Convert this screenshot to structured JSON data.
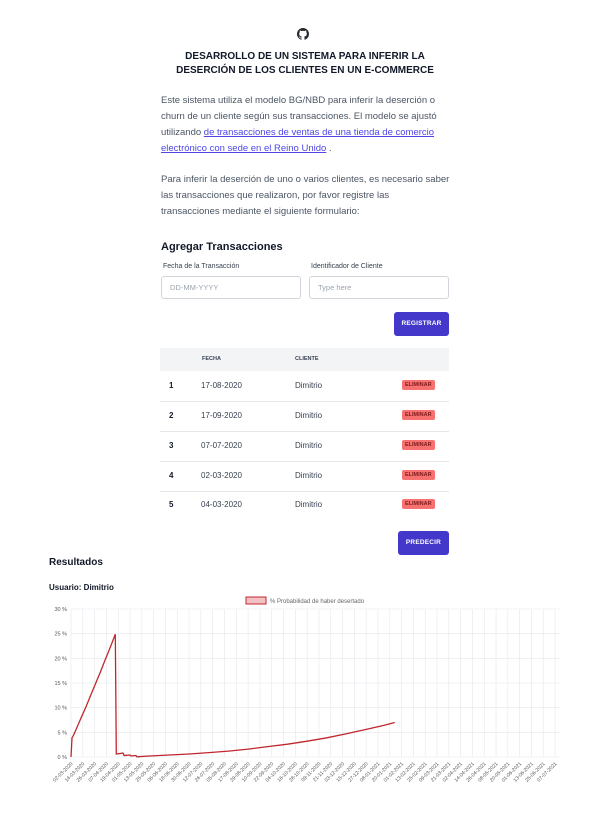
{
  "header": {
    "icon": "github-icon",
    "title_line1": "DESARROLLO DE UN SISTEMA PARA INFERIR LA",
    "title_line2": "DESERCIÓN DE LOS CLIENTES EN UN E-COMMERCE"
  },
  "intro": {
    "p1_line1": "Este sistema utiliza el modelo BG/NBD para inferir la deserción o",
    "p1_line2": "churn de un cliente según sus transacciones. El modelo se ajustó",
    "p1_line3_prefix": "utilizando ",
    "link_line1": "de transacciones de ventas de una tienda de comercio",
    "link_line2": "electrónico con sede en el Reino Unido",
    "p1_suffix": " .",
    "p2_line1": "Para inferir la deserción de uno o varios clientes, es necesario saber",
    "p2_line2": "las transacciones que realizaron, por favor registre las",
    "p2_line3": "transacciones mediante el siguiente formulario:"
  },
  "form": {
    "heading": "Agregar Transacciones",
    "date_label": "Fecha de la Transacción",
    "date_placeholder": "DD-MM-YYYY",
    "client_label": "Identificador de Cliente",
    "client_placeholder": "Type here",
    "submit_label": "REGISTRAR"
  },
  "table": {
    "headers": [
      "",
      "FECHA",
      "CLIENTE",
      ""
    ],
    "rows": [
      {
        "num": "1",
        "date": "17-08-2020",
        "client": "Dimitrio",
        "action": "ELIMINAR"
      },
      {
        "num": "2",
        "date": "17-09-2020",
        "client": "Dimitrio",
        "action": "ELIMINAR"
      },
      {
        "num": "3",
        "date": "07-07-2020",
        "client": "Dimitrio",
        "action": "ELIMINAR"
      },
      {
        "num": "4",
        "date": "02-03-2020",
        "client": "Dimitrio",
        "action": "ELIMINAR"
      },
      {
        "num": "5",
        "date": "04-03-2020",
        "client": "Dimitrio",
        "action": "ELIMINAR"
      }
    ],
    "predict_label": "PREDECIR"
  },
  "results": {
    "heading": "Resultados",
    "user_label": "Usuario: Dimitrio"
  },
  "chart_data": {
    "type": "line",
    "legend": "% Probabilidad de haber desertado",
    "legend_position": "top-center",
    "color": "#c0272d",
    "grid": true,
    "ylim": [
      0,
      30
    ],
    "yticks": [
      "0 %",
      "5 %",
      "10 %",
      "15 %",
      "20 %",
      "25 %",
      "30 %"
    ],
    "xticks": [
      "02-03-2020",
      "14-03-2020",
      "26-03-2020",
      "07-04-2020",
      "19-04-2020",
      "01-05-2020",
      "13-05-2020",
      "25-05-2020",
      "06-06-2020",
      "18-06-2020",
      "30-06-2020",
      "12-07-2020",
      "24-07-2020",
      "05-08-2020",
      "17-08-2020",
      "29-08-2020",
      "10-09-2020",
      "22-09-2020",
      "04-10-2020",
      "16-10-2020",
      "28-10-2020",
      "09-11-2020",
      "21-11-2020",
      "03-12-2020",
      "15-12-2020",
      "27-12-2020",
      "08-01-2021",
      "20-01-2021",
      "01-02-2021",
      "13-02-2021",
      "25-02-2021",
      "09-03-2021",
      "21-03-2021",
      "02-04-2021",
      "14-04-2021",
      "26-04-2021",
      "08-05-2021",
      "20-05-2021",
      "01-06-2021",
      "13-06-2021",
      "25-06-2021",
      "07-07-2021"
    ],
    "series": [
      {
        "name": "% Probabilidad de haber desertado",
        "points": [
          [
            0,
            0
          ],
          [
            1,
            3.9
          ],
          [
            2,
            4.2
          ],
          [
            5,
            5.5
          ],
          [
            10,
            7.8
          ],
          [
            15,
            10.1
          ],
          [
            20,
            12.5
          ],
          [
            25,
            14.9
          ],
          [
            30,
            17.3
          ],
          [
            35,
            19.8
          ],
          [
            40,
            22.3
          ],
          [
            45,
            24.9
          ],
          [
            46,
            0.6
          ],
          [
            53,
            0.8
          ],
          [
            54,
            0.3
          ],
          [
            60,
            0.4
          ],
          [
            61,
            0.2
          ],
          [
            66,
            0.3
          ],
          [
            67,
            0.05
          ],
          [
            80,
            0.2
          ],
          [
            100,
            0.4
          ],
          [
            120,
            0.6
          ],
          [
            140,
            0.9
          ],
          [
            160,
            1.2
          ],
          [
            180,
            1.6
          ],
          [
            200,
            2.1
          ],
          [
            220,
            2.6
          ],
          [
            240,
            3.2
          ],
          [
            260,
            3.9
          ],
          [
            280,
            4.7
          ],
          [
            300,
            5.6
          ],
          [
            320,
            6.5
          ],
          [
            329,
            7.0
          ]
        ]
      }
    ]
  }
}
